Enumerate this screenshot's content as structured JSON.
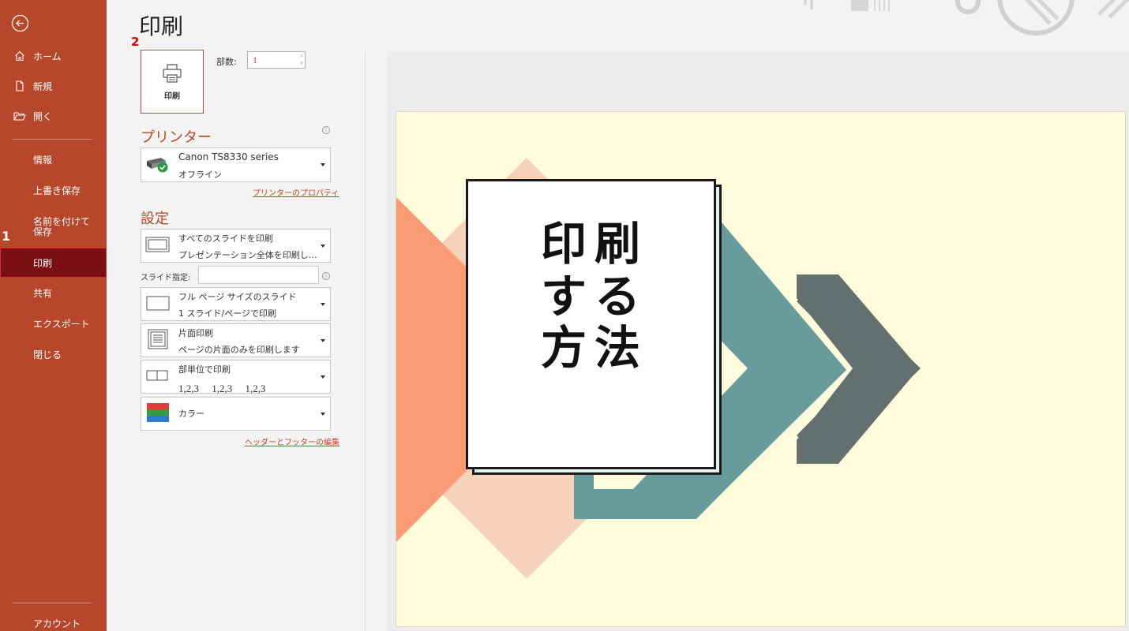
{
  "sidebar": {
    "nav_top": [
      {
        "label": "ホーム",
        "icon": "home-icon"
      },
      {
        "label": "新規",
        "icon": "new-document-icon"
      },
      {
        "label": "開く",
        "icon": "open-folder-icon"
      }
    ],
    "nav_main": [
      {
        "label": "情報"
      },
      {
        "label": "上書き保存"
      },
      {
        "label": "名前を付けて保存"
      },
      {
        "label": "印刷"
      },
      {
        "label": "共有"
      },
      {
        "label": "エクスポート"
      },
      {
        "label": "閉じる"
      }
    ],
    "account_label": "アカウント",
    "marker": "1",
    "accent_color": "#b7472a",
    "selected_color": "#7a1014"
  },
  "header": {
    "title": "印刷",
    "marker": "2"
  },
  "print": {
    "button_label": "印刷",
    "copies_label": "部数:",
    "copies_value": "1"
  },
  "printer": {
    "section_title": "プリンター",
    "name": "Canon TS8330 series",
    "status": "オフライン",
    "properties_link": "プリンターのプロパティ"
  },
  "settings": {
    "section_title": "設定",
    "slides_range": {
      "line1": "すべてのスライドを印刷",
      "line2": "プレゼンテーション全体を印刷し…"
    },
    "slide_spec_label": "スライド指定:",
    "slide_spec_value": "",
    "layout": {
      "line1": "フル ページ サイズのスライド",
      "line2": "1 スライド/ページで印刷"
    },
    "sides": {
      "line1": "片面印刷",
      "line2": "ページの片面のみを印刷します"
    },
    "collate": {
      "line1": "部単位で印刷",
      "line2": "1,2,3　 1,2,3　 1,2,3"
    },
    "color": {
      "line1": "カラー"
    },
    "header_footer_link": "ヘッダーとフッターの編集"
  },
  "preview": {
    "slide_title_chars": [
      "印",
      "刷",
      "す",
      "る",
      "方",
      "法"
    ],
    "background_color": "#fefcdd",
    "shape_colors": {
      "coral": "#fa9b76",
      "peach": "#f5d2b9",
      "teal": "#689c9c",
      "slate": "#627070"
    }
  }
}
